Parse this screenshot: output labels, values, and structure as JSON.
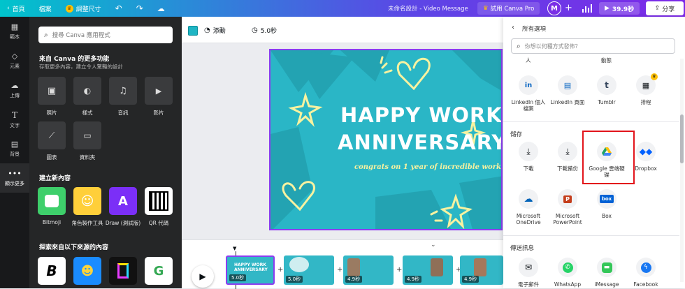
{
  "topbar": {
    "home": "首頁",
    "file": "檔案",
    "resize": "調整尺寸",
    "title": "未命名設計 - Video Message",
    "try_pro": "試用 Canva Pro",
    "avatar_letter": "M",
    "duration": "39.9秒",
    "share": "分享"
  },
  "rail": [
    {
      "label": "範本",
      "icon": "template-icon"
    },
    {
      "label": "元素",
      "icon": "elements-icon"
    },
    {
      "label": "上傳",
      "icon": "upload-icon"
    },
    {
      "label": "文字",
      "icon": "text-icon"
    },
    {
      "label": "背景",
      "icon": "background-icon"
    },
    {
      "label": "顯示更多",
      "icon": "more-icon"
    }
  ],
  "panel": {
    "search_placeholder": "搜尋 Canva 應用程式",
    "more_title": "來自 Canva 的更多功能",
    "more_subtitle": "存取更多內容，建立令人驚豔的設計",
    "features": [
      "照片",
      "樣式",
      "音訊",
      "影片",
      "圖表",
      "資料夾"
    ],
    "create_title": "建立新內容",
    "create_apps": [
      "Bitmoji",
      "角色製作工具",
      "Draw (測試版)",
      "QR 代碼"
    ],
    "explore_title": "探索來自以下來源的內容"
  },
  "toolbar": {
    "animate": "添動",
    "duration": "5.0秒"
  },
  "canvas": {
    "line1": "HAPPY WORK",
    "line2": "ANNIVERSARY",
    "line3": "congrats on 1 year of incredible work!"
  },
  "timeline": {
    "thumbs": [
      "5.0秒",
      "5.0秒",
      "4.9秒",
      "4.9秒",
      "4.9秒"
    ]
  },
  "share_panel": {
    "title": "所有選項",
    "search_placeholder": "你想以何種方式發佈？",
    "top_labels": [
      "人",
      "動態"
    ],
    "row1": [
      "LinkedIn 個人檔案",
      "LinkedIn 頁面",
      "Tumblr",
      "排程"
    ],
    "save_title": "儲存",
    "row2": [
      "下載",
      "下載備份",
      "Google 雲端硬碟",
      "Dropbox"
    ],
    "row3": [
      "Microsoft OneDrive",
      "Microsoft PowerPoint",
      "Box"
    ],
    "message_title": "傳送訊息",
    "row4": [
      "電子郵件",
      "WhatsApp",
      "iMessage",
      "Facebook"
    ]
  },
  "colors": {
    "accent": "#7d2ae8",
    "canvas_bg": "#2ab6c6",
    "highlight": "#e2141b"
  }
}
